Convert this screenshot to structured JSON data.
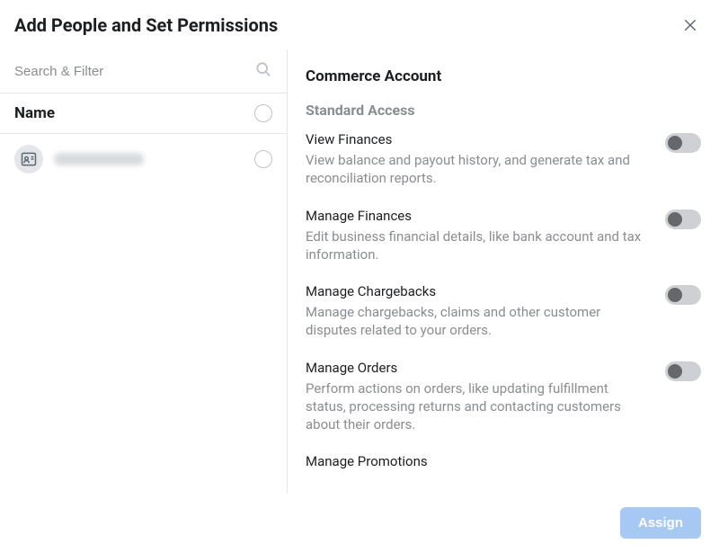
{
  "header": {
    "title": "Add People and Set Permissions"
  },
  "left": {
    "search_placeholder": "Search & Filter",
    "name_header": "Name"
  },
  "right": {
    "section_title": "Commerce Account",
    "subsection_title": "Standard Access",
    "permissions": [
      {
        "title": "View Finances",
        "desc": "View balance and payout history, and generate tax and reconciliation reports."
      },
      {
        "title": "Manage Finances",
        "desc": "Edit business financial details, like bank account and tax information."
      },
      {
        "title": "Manage Chargebacks",
        "desc": "Manage chargebacks, claims and other customer disputes related to your orders."
      },
      {
        "title": "Manage Orders",
        "desc": "Perform actions on orders, like updating fulfillment status, processing returns and contacting customers about their orders."
      },
      {
        "title": "Manage Promotions",
        "desc": ""
      }
    ]
  },
  "footer": {
    "assign_label": "Assign"
  }
}
